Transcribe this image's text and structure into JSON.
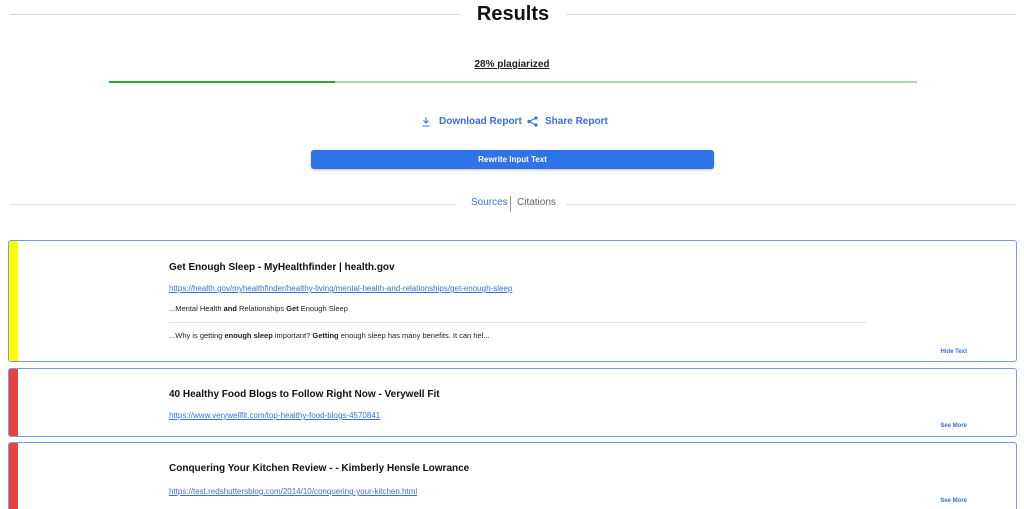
{
  "header": {
    "title": "Results"
  },
  "plagiarism": {
    "label": "28% plagiarized",
    "percent": 28
  },
  "actions": {
    "download_label": "Download Report",
    "share_label": "Share Report"
  },
  "rewrite": {
    "label": "Rewrite Input Text"
  },
  "tabs": {
    "sources": "Sources",
    "citations": "Citations"
  },
  "colors": {
    "accent": "#2f73e8",
    "link": "#3a6fd8",
    "progress": "#2ea82e",
    "severity_yellow": "#ffff00",
    "severity_red": "#e84340"
  },
  "sources": [
    {
      "title": "Get Enough Sleep - MyHealthfinder | health.gov",
      "url": "https://health.gov/myhealthfinder/healthy-living/mental-health-and-relationships/get-enough-sleep",
      "snippet1": {
        "p1": "...Mental Health ",
        "b1": "and",
        "p2": " Relationships ",
        "b2": "Get",
        "p3": " Enough Sleep"
      },
      "snippet2": {
        "p1": "...Why is getting ",
        "b1": "enough sleep",
        "p2": " important? ",
        "b2": "Getting",
        "p3": " enough sleep has many benefits. It can hel..."
      },
      "toggle": "Hide Text"
    },
    {
      "title": "40 Healthy Food Blogs to Follow Right Now - Verywell Fit",
      "url": "https://www.verywellfit.com/top-healthy-food-blogs-4570841",
      "toggle": "See More"
    },
    {
      "title": "Conquering Your Kitchen Review - - Kimberly Hensle Lowrance",
      "url": "https://test.redshuttersblog.com/2014/10/conquering-your-kitchen.html",
      "toggle": "See More"
    }
  ]
}
